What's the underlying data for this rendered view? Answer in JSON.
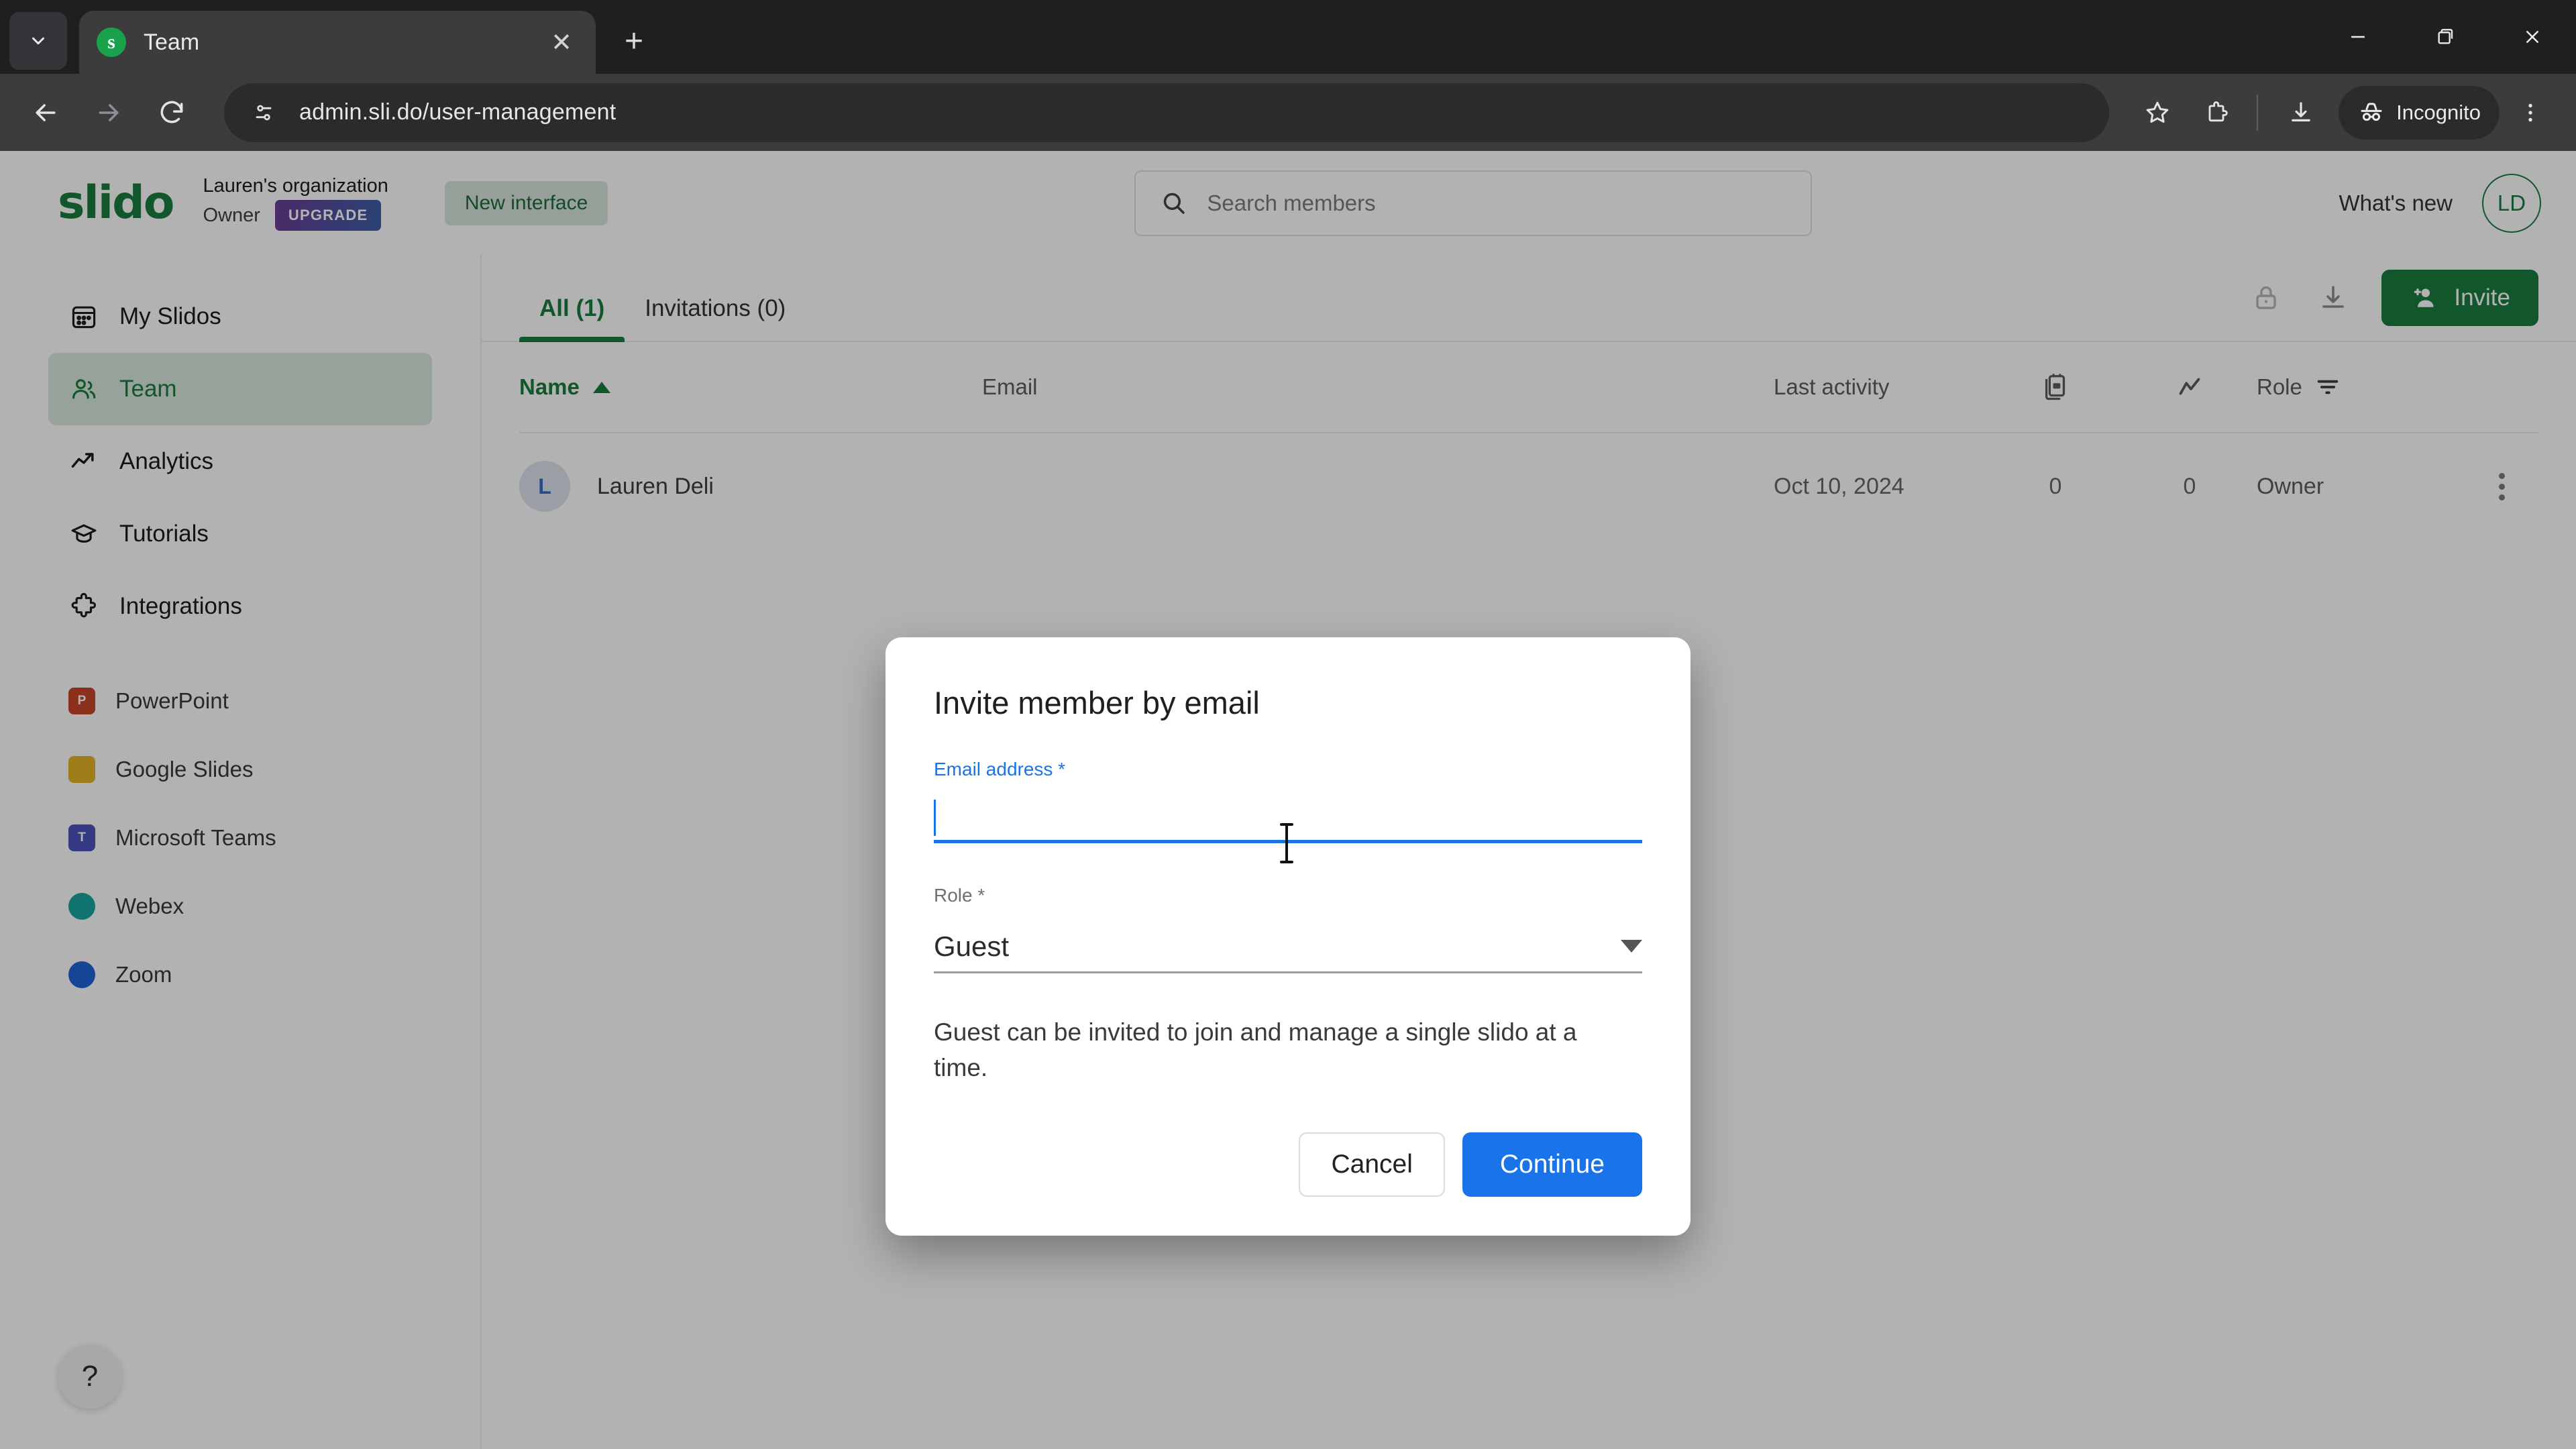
{
  "browser": {
    "tab": {
      "title": "Team",
      "favicon_letter": "s",
      "favicon_color": "#1aa14b"
    },
    "new_tab_label": "+",
    "url": "admin.sli.do/user-management",
    "profile_label": "Incognito",
    "window_controls": {
      "minimize": "−",
      "maximize": "❐",
      "close": "✕"
    }
  },
  "header": {
    "logo": "slido",
    "org_name": "Lauren's organization",
    "org_role": "Owner",
    "upgrade_label": "UPGRADE",
    "new_interface_label": "New interface",
    "search_placeholder": "Search members",
    "whats_new_label": "What's new",
    "avatar_initials": "LD"
  },
  "sidebar": {
    "items": [
      {
        "label": "My Slidos",
        "icon": "calendar-icon",
        "active": false
      },
      {
        "label": "Team",
        "icon": "people-icon",
        "active": true
      },
      {
        "label": "Analytics",
        "icon": "trending-up-icon",
        "active": false
      },
      {
        "label": "Tutorials",
        "icon": "graduation-cap-icon",
        "active": false
      },
      {
        "label": "Integrations",
        "icon": "puzzle-piece-icon",
        "active": false
      }
    ],
    "integrations": [
      {
        "label": "PowerPoint",
        "icon": "powerpoint-icon",
        "color": "#c8452a",
        "glyph": "P"
      },
      {
        "label": "Google Slides",
        "icon": "google-slides-icon",
        "color": "#e4b426",
        "glyph": ""
      },
      {
        "label": "Microsoft Teams",
        "icon": "microsoft-teams-icon",
        "color": "#4b53bc",
        "glyph": "T"
      },
      {
        "label": "Webex",
        "icon": "webex-icon",
        "color": "#17a5a0",
        "glyph": ""
      },
      {
        "label": "Zoom",
        "icon": "zoom-icon",
        "color": "#2164d6",
        "glyph": ""
      }
    ],
    "help_label": "?"
  },
  "content": {
    "tabs": [
      {
        "label": "All (1)",
        "active": true
      },
      {
        "label": "Invitations (0)",
        "active": false
      }
    ],
    "actions": {
      "lock_icon": "lock-icon",
      "download_icon": "download-icon",
      "invite_label": "Invite"
    },
    "table": {
      "columns": {
        "name": "Name",
        "email": "Email",
        "last_activity": "Last activity",
        "slidos_icon": "slides-icon",
        "participants_icon": "trend-icon",
        "role": "Role"
      },
      "sort": {
        "column": "Name",
        "direction": "asc"
      },
      "rows": [
        {
          "avatar_initial": "L",
          "name": "Lauren Deli",
          "email": "",
          "last_activity": "Oct 10, 2024",
          "slidos_count": "0",
          "participants_count": "0",
          "role": "Owner"
        }
      ]
    }
  },
  "modal": {
    "title": "Invite member by email",
    "email_label": "Email address *",
    "email_value": "",
    "email_placeholder": "",
    "role_label": "Role *",
    "role_value": "Guest",
    "description": "Guest can be invited to join and manage a single slido at a time.",
    "cancel_label": "Cancel",
    "continue_label": "Continue",
    "accent_color": "#1a73e8"
  }
}
